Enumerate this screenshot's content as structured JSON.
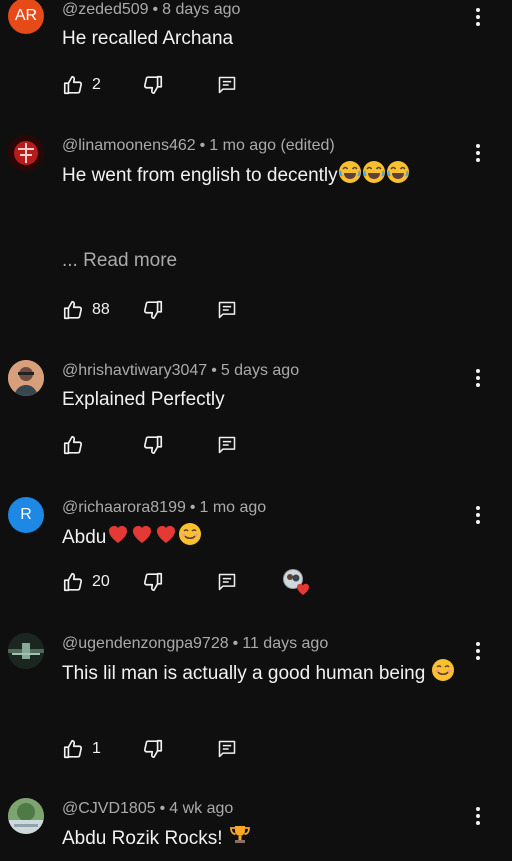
{
  "comments": [
    {
      "avatar_initials": "AR",
      "avatar_color": "#e64a19",
      "handle": "@zeded509",
      "age": "8 days ago",
      "text": "He recalled Archana",
      "likes": "2",
      "reply_icon": "comment-reply-icon"
    },
    {
      "avatar_color": "#b71c1c",
      "handle": "@linamoonens462",
      "age": "1 mo ago (edited)",
      "text": "He went from english to decently",
      "emoji": [
        "laugh-emoji",
        "laugh-emoji",
        "laugh-emoji"
      ],
      "read_more": "... Read more",
      "likes": "88"
    },
    {
      "avatar_color": "#c9825b",
      "handle": "@hrishavtiwary3047",
      "age": "5 days ago",
      "text": "Explained Perfectly",
      "likes": ""
    },
    {
      "avatar_initials": "R",
      "avatar_color": "#1e88e5",
      "handle": "@richaarora8199",
      "age": "1 mo ago",
      "text": "Abdu",
      "emoji": [
        "red-heart-emoji",
        "red-heart-emoji",
        "red-heart-emoji",
        "smile-emoji"
      ],
      "likes": "20",
      "creator_hearted": true
    },
    {
      "avatar_color": "#2e3b33",
      "handle": "@ugendenzongpa9728",
      "age": "11 days ago",
      "text": "This lil man is actually a good human being",
      "emoji": [
        "smile-emoji"
      ],
      "likes": "1"
    },
    {
      "avatar_color": "#5a7a52",
      "handle": "@CJVD1805",
      "age": "4 wk ago",
      "text": "Abdu Rozik Rocks!",
      "emoji": [
        "trophy-emoji"
      ]
    }
  ],
  "separator": "•"
}
